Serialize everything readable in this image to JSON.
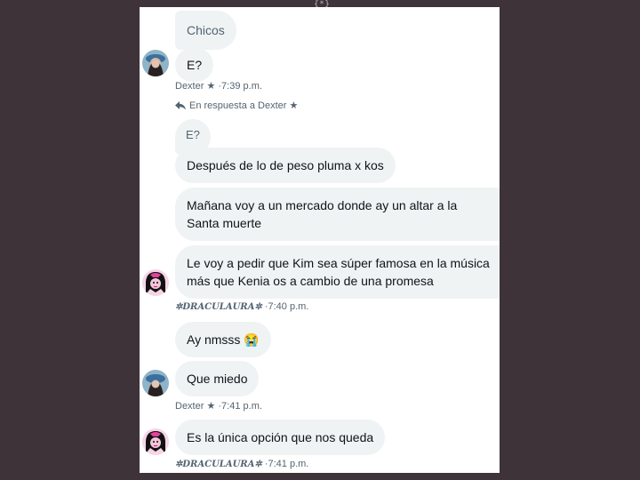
{
  "top_handle": "{*}",
  "messages": {
    "m1": "Chicos",
    "m2": "E?",
    "meta1_name": "Dexter ★",
    "meta1_time": "·7:39 p.m.",
    "reply_label": "En respuesta a Dexter ★",
    "quote": "E?",
    "m3": "Después de lo de peso pluma x kos",
    "m4": "Mañana voy a un mercado donde ay un altar a la Santa muerte",
    "m5": "Le voy a pedir que Kim sea súper famosa en la música más que Kenia os a cambio de una promesa",
    "meta2_name": "✲DRACULAURA✲",
    "meta2_time": "·7:40 p.m.",
    "m6": "Ay nmsss 😭",
    "m7": "Que miedo",
    "meta3_name": "Dexter ★",
    "meta3_time": "·7:41 p.m.",
    "m8": "Es la única opción que nos queda",
    "meta4_name": "✲DRACULAURA✲",
    "meta4_time": "·7:41 p.m."
  },
  "colors": {
    "background": "#3d3339",
    "bubble": "#eff3f4",
    "meta_text": "#536471"
  }
}
